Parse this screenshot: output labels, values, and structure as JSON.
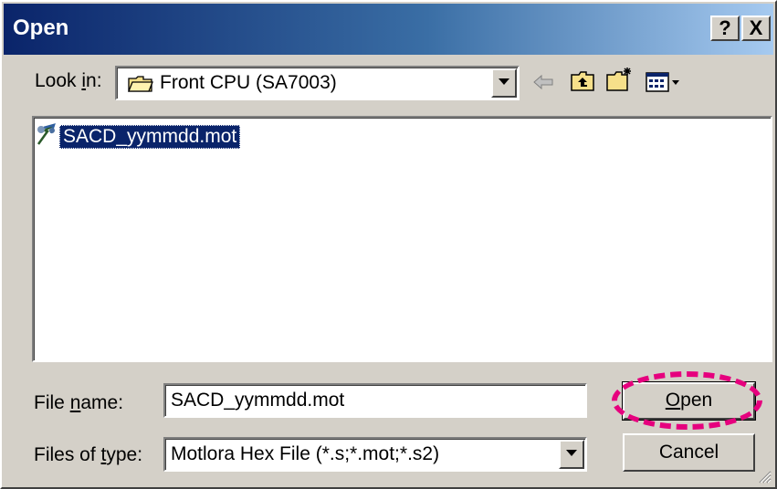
{
  "window": {
    "title": "Open",
    "help_label": "?",
    "close_label": "X"
  },
  "look_in": {
    "label_prefix": "Look ",
    "label_accel": "i",
    "label_suffix": "n:",
    "value": "Front CPU (SA7003)"
  },
  "toolbar": {
    "back_icon": "back-arrow-icon",
    "up_icon": "up-folder-icon",
    "new_folder_icon": "new-folder-icon",
    "view_icon": "view-menu-icon"
  },
  "files": [
    {
      "name": "SACD_yymmdd.mot",
      "icon": "file-icon",
      "selected": true
    }
  ],
  "file_name": {
    "label_prefix": "File ",
    "label_accel": "n",
    "label_suffix": "ame:",
    "value": "SACD_yymmdd.mot"
  },
  "file_type": {
    "label_prefix": "Files of ",
    "label_accel": "t",
    "label_suffix": "ype:",
    "value": "Motlora Hex File (*.s;*.mot;*.s2)"
  },
  "buttons": {
    "open_accel": "O",
    "open_rest": "pen",
    "cancel": "Cancel"
  },
  "colors": {
    "highlight_ring": "#e6007e",
    "selection": "#0a246a"
  }
}
